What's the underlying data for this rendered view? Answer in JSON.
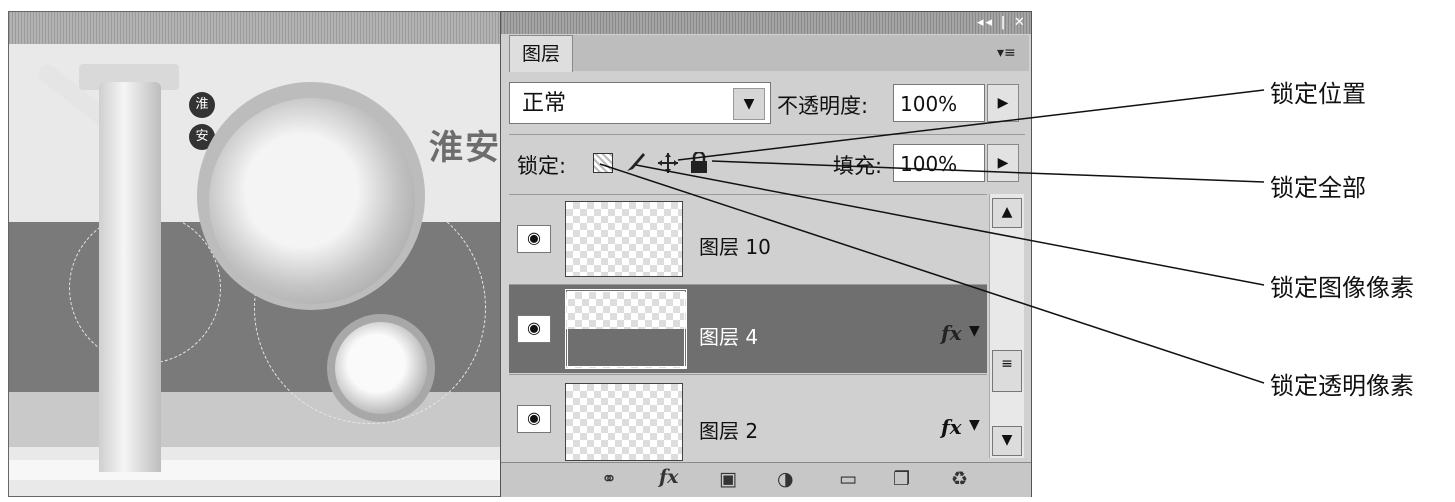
{
  "canvas": {
    "badge_1": "淮",
    "badge_2": "安",
    "title_fragment": "淮安"
  },
  "panel": {
    "window_controls": "◂◂ | ✕",
    "tab_label": "图层",
    "menu_icon": "▾≡",
    "blend_mode": "正常",
    "opacity_label": "不透明度:",
    "opacity_value": "100%",
    "lock_label": "锁定:",
    "fill_label": "填充:",
    "fill_value": "100%",
    "layers": [
      {
        "name": "图层 10",
        "fx": "",
        "selected": false
      },
      {
        "name": "图层 4",
        "fx": "fx",
        "selected": true
      },
      {
        "name": "图层 2",
        "fx": "fx",
        "selected": false
      }
    ],
    "bottom_icons": [
      "link-icon",
      "fx-icon",
      "mask-icon",
      "adjustment-icon",
      "folder-icon",
      "new-layer-icon",
      "trash-icon"
    ]
  },
  "annotations": {
    "lock_position": "锁定位置",
    "lock_all": "锁定全部",
    "lock_image_pixels": "锁定图像像素",
    "lock_transparent_pixels": "锁定透明像素"
  }
}
